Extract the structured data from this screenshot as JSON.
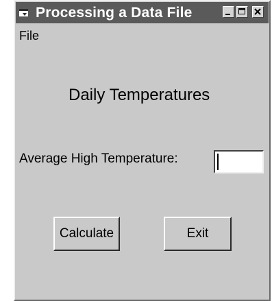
{
  "window": {
    "title": "Processing a Data File",
    "menu": {
      "file_label": "File"
    }
  },
  "form": {
    "heading": "Daily Temperatures",
    "average_label": "Average High Temperature:",
    "average_value": ""
  },
  "buttons": {
    "calculate_label": "Calculate",
    "exit_label": "Exit"
  },
  "icons": {
    "system": "window-system-icon",
    "minimize": "minimize-icon",
    "maximize": "maximize-icon",
    "close": "close-icon"
  },
  "colors": {
    "titlebar": "#5a5a5a",
    "window_face": "#c9c9c9",
    "textbox_bg": "#ffffff"
  }
}
